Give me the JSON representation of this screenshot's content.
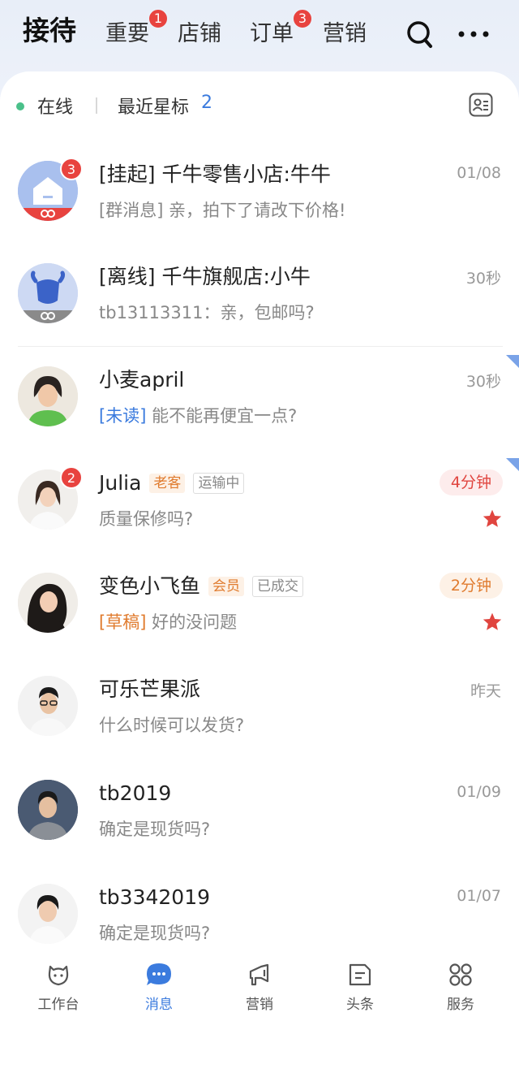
{
  "header": {
    "tabs": [
      {
        "label": "接待",
        "active": true,
        "badge": null
      },
      {
        "label": "重要",
        "active": false,
        "badge": "1"
      },
      {
        "label": "店铺",
        "active": false,
        "badge": null
      },
      {
        "label": "订单",
        "active": false,
        "badge": "3"
      },
      {
        "label": "营销",
        "active": false,
        "badge": null
      }
    ],
    "icons": [
      "search-icon",
      "more-icon"
    ]
  },
  "status_bar": {
    "online_label": "在线",
    "starred_label": "最近星标",
    "starred_count": "2",
    "icon": "contact-card-icon"
  },
  "conversations": [
    {
      "name": "[挂起] 千牛零售小店:牛牛",
      "preview": "[群消息] 亲，拍下了请改下价格!",
      "time": "01/08",
      "badge": "3",
      "avatar": "store-house-icon"
    },
    {
      "name": "[离线] 千牛旗舰店:小牛",
      "preview": "tb13113311：亲，包邮吗?",
      "time": "30秒",
      "badge": null,
      "avatar": "cow-icon"
    },
    {
      "name": "小麦april",
      "preview_prefix": "[未读]",
      "preview": "能不能再便宜一点?",
      "time": "30秒",
      "badge": null,
      "avatar": "person-photo"
    },
    {
      "name": "Julia",
      "tags": [
        "老客",
        "运输中"
      ],
      "preview": "质量保修吗?",
      "time": "4分钟",
      "badge": "2",
      "starred": true,
      "avatar": "person-photo"
    },
    {
      "name": "变色小飞鱼",
      "tags": [
        "会员",
        "已成交"
      ],
      "preview_prefix": "[草稿]",
      "preview": "好的没问题",
      "time": "2分钟",
      "badge": null,
      "starred": true,
      "avatar": "person-photo"
    },
    {
      "name": "可乐芒果派",
      "preview": "什么时候可以发货?",
      "time": "昨天",
      "badge": null,
      "avatar": "person-photo"
    },
    {
      "name": "tb2019",
      "preview": "确定是现货吗?",
      "time": "01/09",
      "badge": null,
      "avatar": "person-photo"
    },
    {
      "name": "tb3342019",
      "preview": "确定是现货吗?",
      "time": "01/07",
      "badge": null,
      "avatar": "person-photo"
    }
  ],
  "bottom_nav": [
    {
      "label": "工作台",
      "icon": "workbench-icon",
      "active": false
    },
    {
      "label": "消息",
      "icon": "message-icon",
      "active": true
    },
    {
      "label": "营销",
      "icon": "megaphone-icon",
      "active": false
    },
    {
      "label": "头条",
      "icon": "headline-icon",
      "active": false
    },
    {
      "label": "服务",
      "icon": "services-grid-icon",
      "active": false
    }
  ],
  "colors": {
    "accent_blue": "#3b7bde",
    "badge_red": "#e8433f",
    "star_red": "#e0453f",
    "tag_orange": "#e07b2e",
    "online_green": "#4ac08a"
  }
}
